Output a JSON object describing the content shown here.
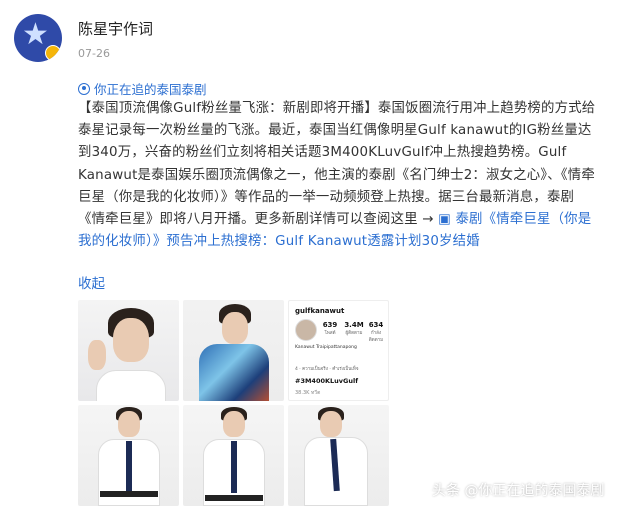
{
  "post": {
    "author": "陈星宇作词",
    "date": "07-26",
    "topic": "你正在追的泰国泰剧",
    "body": {
      "lead_bold": "【泰国顶流偶像Gulf粉丝量飞涨：新剧即将开播】",
      "text": "泰国饭圈流行用冲上趋势榜的方式给泰星记录每一次粉丝量的飞涨。最近，泰国当红偶像明星Gulf kanawut的IG粉丝量达到340万，兴奋的粉丝们立刻将相关话题3M400KLuvGulf冲上热搜趋势榜。Gulf Kanawut是泰国娱乐圈顶流偶像之一，他主演的泰剧《名门绅士2：淑女之心》、《情牵巨星（你是我的化妆师）》等作品的一举一动频频登上热搜。据三台最新消息，泰剧《情牵巨星》即将八月开播。更多新剧详情可以查阅这里 ",
      "arrow": "→",
      "link": "泰剧《情牵巨星（你是我的化妆师）》预告冲上热搜榜：Gulf Kanawut透露计划30岁结婚"
    },
    "collapse_label": "收起"
  },
  "instagram": {
    "username": "gulfkanawut",
    "posts": "639",
    "posts_label": "โพสต์",
    "followers": "3.4M",
    "followers_label": "ผู้ติดตาม",
    "following": "634",
    "following_label": "กำลังติดตาม",
    "name": "Kanawut Traipipattanapong",
    "line": "4 · ความเป็นจริง · คำเร่งเป็นเท็จ",
    "hashtag": "#3M400KLuvGulf",
    "views": "38.3K ทวีต"
  },
  "watermark": "头条 @你正在追的泰国泰剧",
  "colors": {
    "link": "#2c6fd1",
    "text": "#333333",
    "meta": "#999999"
  }
}
